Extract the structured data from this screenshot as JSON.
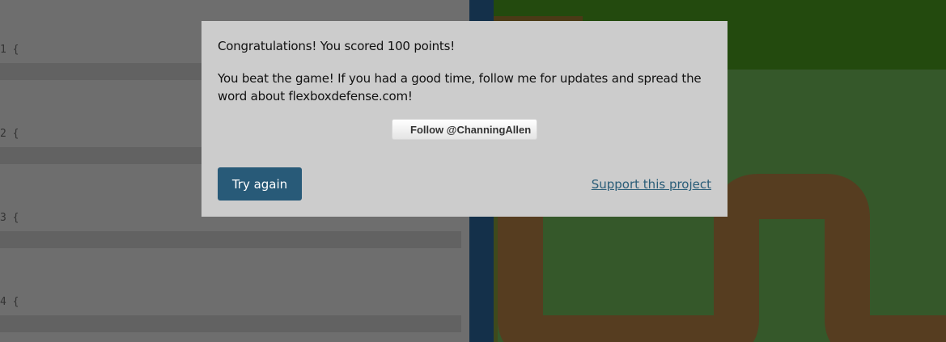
{
  "editor": {
    "blocks": [
      {
        "line": "1 {"
      },
      {
        "line": "2 {"
      },
      {
        "line": "3 {"
      },
      {
        "line": "4 {"
      }
    ]
  },
  "modal": {
    "score_text": "Congratulations! You scored 100 points!",
    "beat_text": "You beat the game! If you had a good time, follow me for updates and spread the word about flexboxdefense.com!",
    "follow_label": "Follow @ChanningAllen",
    "try_again_label": "Try again",
    "support_label": "Support this project"
  },
  "colors": {
    "accent": "#285a78",
    "link": "#2a5d78",
    "modal_bg": "#cccccc",
    "board_grass": "#35582a",
    "board_path": "#563d20",
    "divider": "#14304a"
  }
}
